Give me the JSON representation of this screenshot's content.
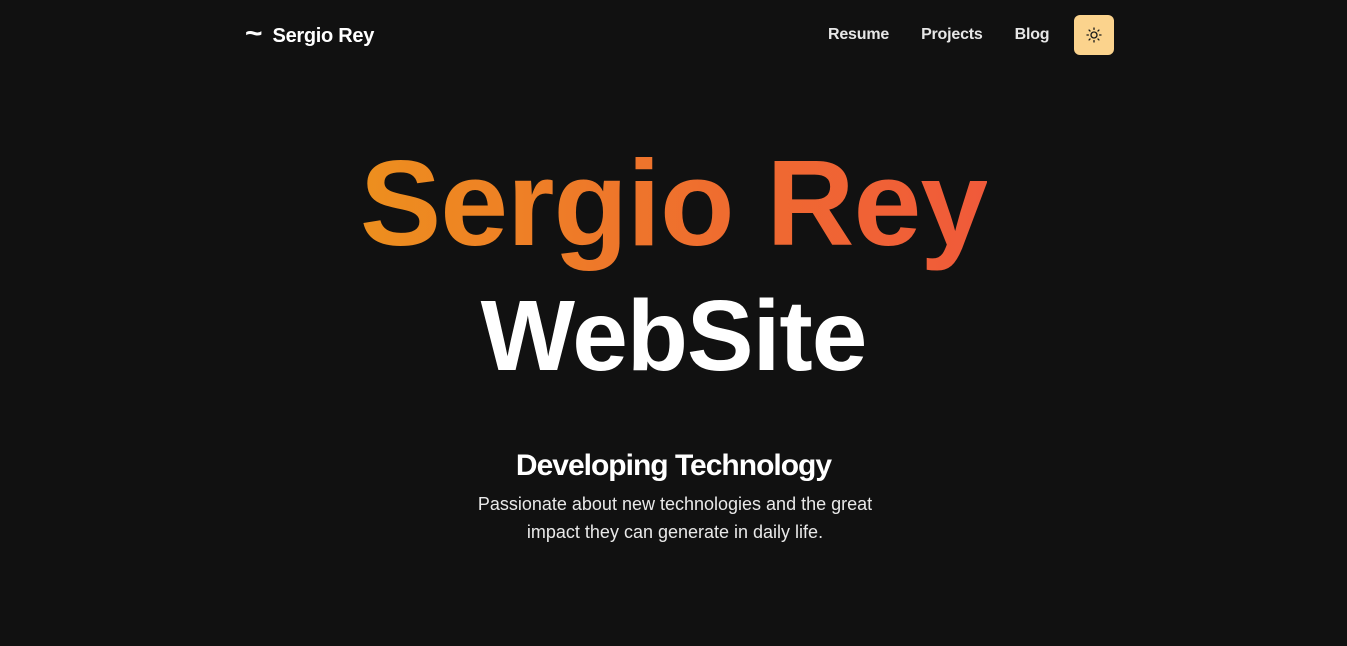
{
  "header": {
    "brand_symbol": "~",
    "brand_name": "Sergio Rey",
    "nav": {
      "resume": "Resume",
      "projects": "Projects",
      "blog": "Blog"
    },
    "theme_toggle_icon": "sun-icon"
  },
  "hero": {
    "title": "Sergio Rey",
    "subtitle": "WebSite"
  },
  "intro": {
    "heading": "Developing Technology",
    "text": "Passionate about new technologies and the great impact they can generate in daily life."
  },
  "colors": {
    "background": "#111111",
    "accent_gradient_start": "#ed8f1e",
    "accent_gradient_end": "#f05a3a",
    "theme_button": "#fbd38d"
  }
}
